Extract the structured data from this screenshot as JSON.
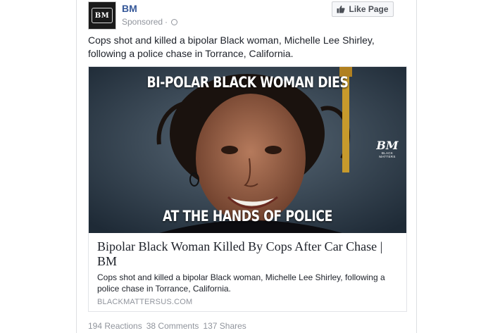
{
  "post": {
    "page_name": "BM",
    "avatar_text": "BM",
    "sponsored_label": "Sponsored",
    "separator": "·",
    "globe_icon": "globe-icon",
    "like_button_label": "Like Page",
    "like_icon": "thumbs-up-icon",
    "text": "Cops shot and killed a bipolar Black woman, Michelle Lee Shirley, following a police chase in Torrance, California."
  },
  "card": {
    "image_headline_top": "BI-POLAR BLACK WOMAN DIES",
    "image_headline_bottom": "AT THE HANDS OF POLICE",
    "image_logo_mark": "BM",
    "image_logo_text": "BLACK MATTERS",
    "title": "Bipolar Black Woman Killed By Cops After Car Chase | BM",
    "description": "Cops shot and killed a bipolar Black woman, Michelle Lee Shirley, following a police chase in Torrance, California.",
    "domain": "BLACKMATTERSUS.COM"
  },
  "stats": {
    "reactions": "194 Reactions",
    "comments": "38 Comments",
    "shares": "137 Shares"
  },
  "colors": {
    "link_blue": "#365899",
    "meta_gray": "#90949c",
    "text": "#1d2129"
  }
}
